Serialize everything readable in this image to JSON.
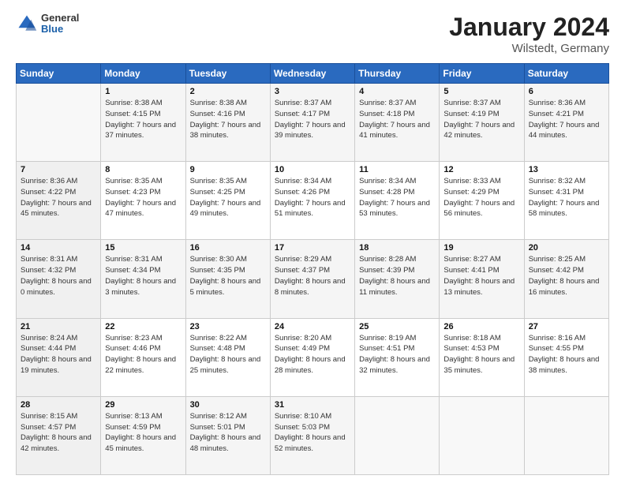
{
  "logo": {
    "general": "General",
    "blue": "Blue"
  },
  "header": {
    "title": "January 2024",
    "subtitle": "Wilstedt, Germany"
  },
  "columns": [
    "Sunday",
    "Monday",
    "Tuesday",
    "Wednesday",
    "Thursday",
    "Friday",
    "Saturday"
  ],
  "weeks": [
    [
      {
        "day": "",
        "sunrise": "",
        "sunset": "",
        "daylight": ""
      },
      {
        "day": "1",
        "sunrise": "Sunrise: 8:38 AM",
        "sunset": "Sunset: 4:15 PM",
        "daylight": "Daylight: 7 hours and 37 minutes."
      },
      {
        "day": "2",
        "sunrise": "Sunrise: 8:38 AM",
        "sunset": "Sunset: 4:16 PM",
        "daylight": "Daylight: 7 hours and 38 minutes."
      },
      {
        "day": "3",
        "sunrise": "Sunrise: 8:37 AM",
        "sunset": "Sunset: 4:17 PM",
        "daylight": "Daylight: 7 hours and 39 minutes."
      },
      {
        "day": "4",
        "sunrise": "Sunrise: 8:37 AM",
        "sunset": "Sunset: 4:18 PM",
        "daylight": "Daylight: 7 hours and 41 minutes."
      },
      {
        "day": "5",
        "sunrise": "Sunrise: 8:37 AM",
        "sunset": "Sunset: 4:19 PM",
        "daylight": "Daylight: 7 hours and 42 minutes."
      },
      {
        "day": "6",
        "sunrise": "Sunrise: 8:36 AM",
        "sunset": "Sunset: 4:21 PM",
        "daylight": "Daylight: 7 hours and 44 minutes."
      }
    ],
    [
      {
        "day": "7",
        "sunrise": "Sunrise: 8:36 AM",
        "sunset": "Sunset: 4:22 PM",
        "daylight": "Daylight: 7 hours and 45 minutes."
      },
      {
        "day": "8",
        "sunrise": "Sunrise: 8:35 AM",
        "sunset": "Sunset: 4:23 PM",
        "daylight": "Daylight: 7 hours and 47 minutes."
      },
      {
        "day": "9",
        "sunrise": "Sunrise: 8:35 AM",
        "sunset": "Sunset: 4:25 PM",
        "daylight": "Daylight: 7 hours and 49 minutes."
      },
      {
        "day": "10",
        "sunrise": "Sunrise: 8:34 AM",
        "sunset": "Sunset: 4:26 PM",
        "daylight": "Daylight: 7 hours and 51 minutes."
      },
      {
        "day": "11",
        "sunrise": "Sunrise: 8:34 AM",
        "sunset": "Sunset: 4:28 PM",
        "daylight": "Daylight: 7 hours and 53 minutes."
      },
      {
        "day": "12",
        "sunrise": "Sunrise: 8:33 AM",
        "sunset": "Sunset: 4:29 PM",
        "daylight": "Daylight: 7 hours and 56 minutes."
      },
      {
        "day": "13",
        "sunrise": "Sunrise: 8:32 AM",
        "sunset": "Sunset: 4:31 PM",
        "daylight": "Daylight: 7 hours and 58 minutes."
      }
    ],
    [
      {
        "day": "14",
        "sunrise": "Sunrise: 8:31 AM",
        "sunset": "Sunset: 4:32 PM",
        "daylight": "Daylight: 8 hours and 0 minutes."
      },
      {
        "day": "15",
        "sunrise": "Sunrise: 8:31 AM",
        "sunset": "Sunset: 4:34 PM",
        "daylight": "Daylight: 8 hours and 3 minutes."
      },
      {
        "day": "16",
        "sunrise": "Sunrise: 8:30 AM",
        "sunset": "Sunset: 4:35 PM",
        "daylight": "Daylight: 8 hours and 5 minutes."
      },
      {
        "day": "17",
        "sunrise": "Sunrise: 8:29 AM",
        "sunset": "Sunset: 4:37 PM",
        "daylight": "Daylight: 8 hours and 8 minutes."
      },
      {
        "day": "18",
        "sunrise": "Sunrise: 8:28 AM",
        "sunset": "Sunset: 4:39 PM",
        "daylight": "Daylight: 8 hours and 11 minutes."
      },
      {
        "day": "19",
        "sunrise": "Sunrise: 8:27 AM",
        "sunset": "Sunset: 4:41 PM",
        "daylight": "Daylight: 8 hours and 13 minutes."
      },
      {
        "day": "20",
        "sunrise": "Sunrise: 8:25 AM",
        "sunset": "Sunset: 4:42 PM",
        "daylight": "Daylight: 8 hours and 16 minutes."
      }
    ],
    [
      {
        "day": "21",
        "sunrise": "Sunrise: 8:24 AM",
        "sunset": "Sunset: 4:44 PM",
        "daylight": "Daylight: 8 hours and 19 minutes."
      },
      {
        "day": "22",
        "sunrise": "Sunrise: 8:23 AM",
        "sunset": "Sunset: 4:46 PM",
        "daylight": "Daylight: 8 hours and 22 minutes."
      },
      {
        "day": "23",
        "sunrise": "Sunrise: 8:22 AM",
        "sunset": "Sunset: 4:48 PM",
        "daylight": "Daylight: 8 hours and 25 minutes."
      },
      {
        "day": "24",
        "sunrise": "Sunrise: 8:20 AM",
        "sunset": "Sunset: 4:49 PM",
        "daylight": "Daylight: 8 hours and 28 minutes."
      },
      {
        "day": "25",
        "sunrise": "Sunrise: 8:19 AM",
        "sunset": "Sunset: 4:51 PM",
        "daylight": "Daylight: 8 hours and 32 minutes."
      },
      {
        "day": "26",
        "sunrise": "Sunrise: 8:18 AM",
        "sunset": "Sunset: 4:53 PM",
        "daylight": "Daylight: 8 hours and 35 minutes."
      },
      {
        "day": "27",
        "sunrise": "Sunrise: 8:16 AM",
        "sunset": "Sunset: 4:55 PM",
        "daylight": "Daylight: 8 hours and 38 minutes."
      }
    ],
    [
      {
        "day": "28",
        "sunrise": "Sunrise: 8:15 AM",
        "sunset": "Sunset: 4:57 PM",
        "daylight": "Daylight: 8 hours and 42 minutes."
      },
      {
        "day": "29",
        "sunrise": "Sunrise: 8:13 AM",
        "sunset": "Sunset: 4:59 PM",
        "daylight": "Daylight: 8 hours and 45 minutes."
      },
      {
        "day": "30",
        "sunrise": "Sunrise: 8:12 AM",
        "sunset": "Sunset: 5:01 PM",
        "daylight": "Daylight: 8 hours and 48 minutes."
      },
      {
        "day": "31",
        "sunrise": "Sunrise: 8:10 AM",
        "sunset": "Sunset: 5:03 PM",
        "daylight": "Daylight: 8 hours and 52 minutes."
      },
      {
        "day": "",
        "sunrise": "",
        "sunset": "",
        "daylight": ""
      },
      {
        "day": "",
        "sunrise": "",
        "sunset": "",
        "daylight": ""
      },
      {
        "day": "",
        "sunrise": "",
        "sunset": "",
        "daylight": ""
      }
    ]
  ]
}
